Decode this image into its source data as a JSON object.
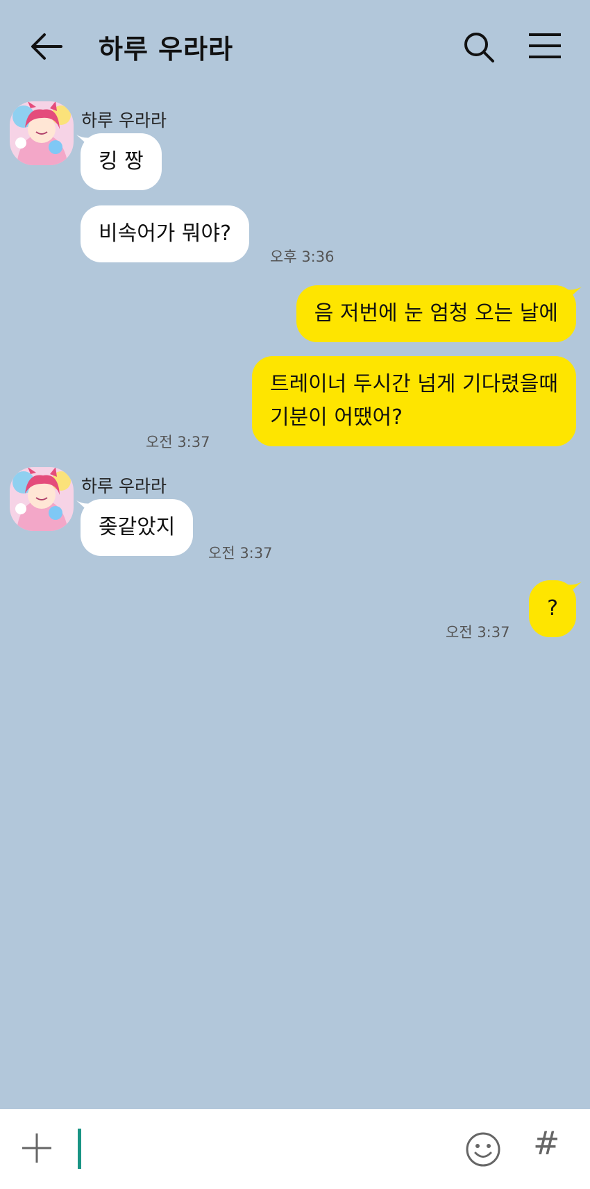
{
  "header": {
    "title": "하루 우라라",
    "back_icon": "arrow-left-icon",
    "search_icon": "search-icon",
    "menu_icon": "hamburger-menu-icon"
  },
  "messages": [
    {
      "side": "in",
      "sender": "하루 우라라",
      "text": "킹 짱",
      "time": ""
    },
    {
      "side": "in",
      "sender": "",
      "text": "비속어가 뭐야?",
      "time": "오후 3:36"
    },
    {
      "side": "out",
      "text": "음 저번에 눈 엄청 오는 날에",
      "time": ""
    },
    {
      "side": "out",
      "lines": [
        "트레이너 두시간 넘게 기다렸을때",
        "기분이 어땠어?"
      ],
      "time": "오전 3:37"
    },
    {
      "side": "in",
      "sender": "하루 우라라",
      "text": "좆같았지",
      "time": "오전 3:37"
    },
    {
      "side": "out",
      "text": "?",
      "time": "오전 3:37"
    }
  ],
  "input": {
    "placeholder": "",
    "plus_icon": "plus-icon",
    "emoji_icon": "smiley-icon",
    "hashtag_label": "#"
  },
  "colors": {
    "background": "#b2c7da",
    "incoming_bubble": "#ffffff",
    "outgoing_bubble": "#fee500",
    "cursor": "#1a9484"
  }
}
